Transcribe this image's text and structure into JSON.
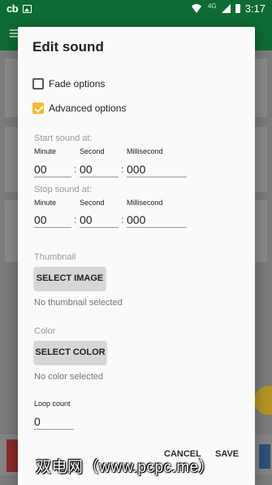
{
  "status_bar": {
    "app_logo": "cb",
    "network": "4G",
    "time": "3:17",
    "icons": [
      "image-icon",
      "wifi-icon",
      "signal-icon",
      "battery-icon"
    ]
  },
  "dialog": {
    "title": "Edit sound",
    "fade_options": {
      "label": "Fade options",
      "checked": false
    },
    "advanced_options": {
      "label": "Advanced options",
      "checked": true
    },
    "start": {
      "label": "Start sound at:",
      "minute_label": "Minute",
      "minute": "00",
      "second_label": "Second",
      "second": "00",
      "ms_label": "Millisecond",
      "ms": "000"
    },
    "stop": {
      "label": "Stop sound at:",
      "minute_label": "Minute",
      "minute": "00",
      "second_label": "Second",
      "second": "00",
      "ms_label": "Millisecond",
      "ms": "000"
    },
    "separator": ":",
    "thumbnail": {
      "label": "Thumbnail",
      "button": "SELECT IMAGE",
      "status": "No thumbnail selected"
    },
    "color": {
      "label": "Color",
      "button": "SELECT COLOR",
      "status": "No color selected"
    },
    "loop": {
      "label": "Loop count",
      "value": "0"
    },
    "cancel": "CANCEL",
    "save": "SAVE"
  },
  "watermark": "双电网（www.pcpc.me）",
  "colors": {
    "checkbox_accent": "#f6b92b",
    "status_bar": "#0d6b33",
    "dialog_bg": "#fafafa",
    "button_gray": "#d6d6d6"
  }
}
